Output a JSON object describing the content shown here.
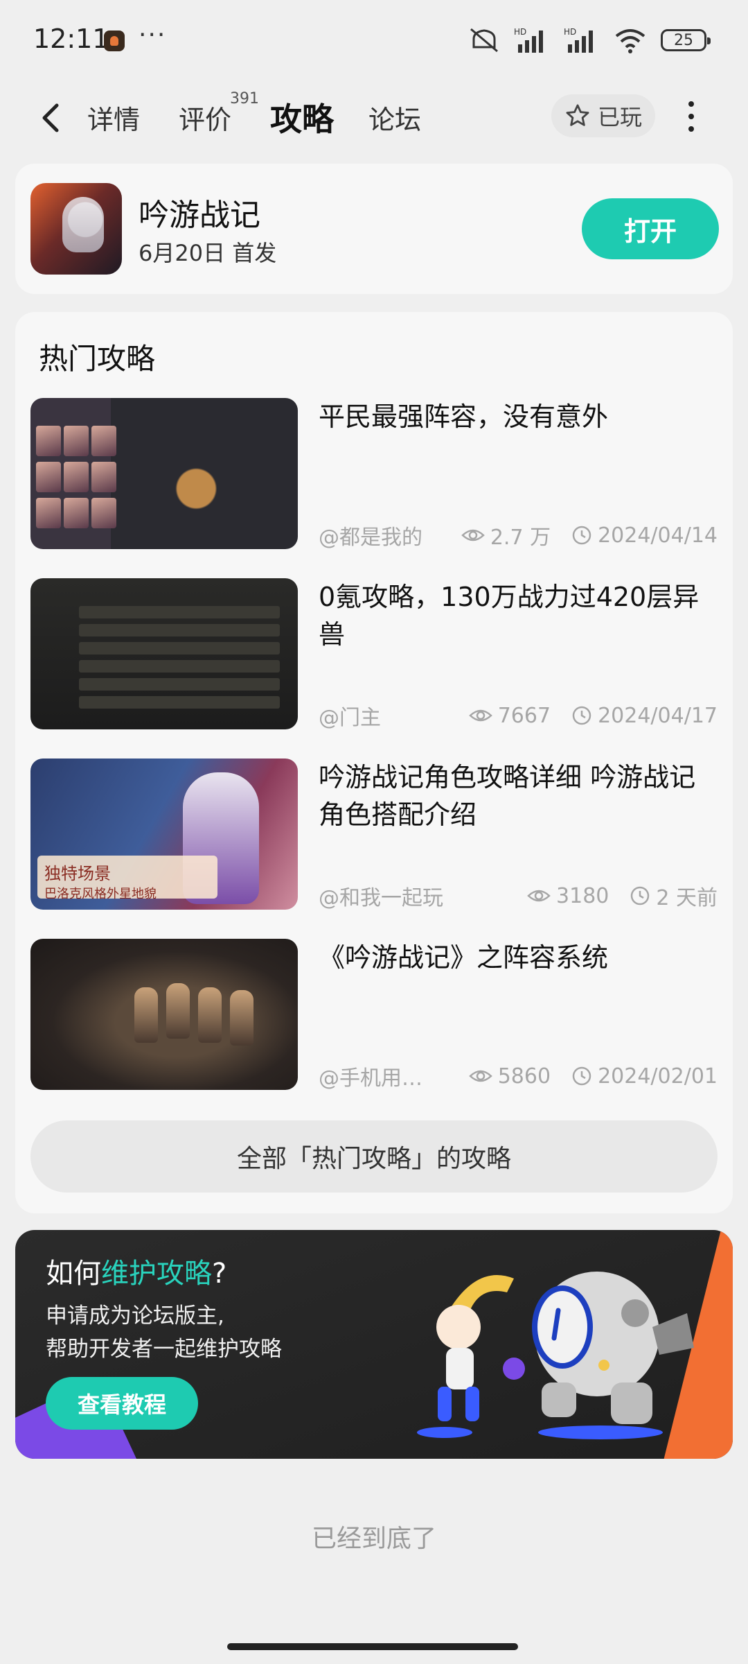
{
  "status_bar": {
    "time": "12:11",
    "dots": "···",
    "battery": "25",
    "network_label_1": "HD",
    "network_label_2": "HD"
  },
  "nav": {
    "tabs": [
      {
        "label": "详情"
      },
      {
        "label": "评价",
        "badge": "391"
      },
      {
        "label": "攻略",
        "active": true
      },
      {
        "label": "论坛"
      }
    ],
    "played_label": "已玩"
  },
  "game": {
    "name": "吟游战记",
    "release": "6月20日 首发",
    "open_label": "打开"
  },
  "guides": {
    "section_title": "热门攻略",
    "items": [
      {
        "title": "平民最强阵容，没有意外",
        "author": "@都是我的",
        "views": "2.7 万",
        "date": "2024/04/14"
      },
      {
        "title": "0氪攻略，130万战力过420层异兽",
        "author": "@门主",
        "views": "7667",
        "date": "2024/04/17"
      },
      {
        "title": "吟游战记角色攻略详细 吟游战记角色搭配介绍",
        "author": "@和我一起玩",
        "views": "3180",
        "date": "2 天前"
      },
      {
        "title": "《吟游战记》之阵容系统",
        "author": "@手机用…",
        "views": "5860",
        "date": "2024/02/01"
      }
    ],
    "thumb_texts": {
      "banner_line1": "独特场景",
      "banner_line2": "巴洛克风格外星地貌"
    },
    "all_label": "全部「热门攻略」的攻略"
  },
  "promo": {
    "title_prefix": "如何",
    "title_highlight": "维护攻略",
    "title_suffix": "?",
    "line1": "申请成为论坛版主,",
    "line2": "帮助开发者一起维护攻略",
    "button_label": "查看教程"
  },
  "footer": {
    "end_text": "已经到底了"
  },
  "colors": {
    "accent": "#1ecbb1",
    "highlight": "#29d3bd",
    "background": "#efefef",
    "card": "#f7f7f7",
    "promo_bg": "#222222",
    "promo_orange": "#f26f33",
    "promo_purple": "#7b4ae6"
  }
}
